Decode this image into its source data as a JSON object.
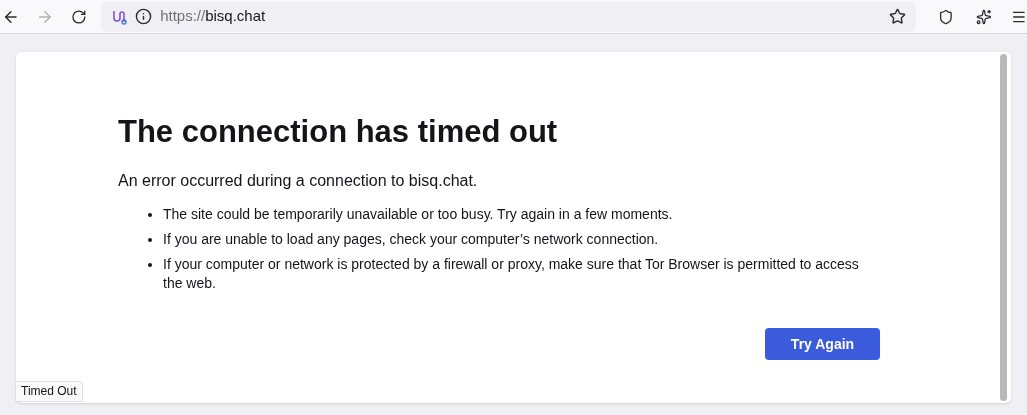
{
  "toolbar": {
    "back_disabled": false,
    "forward_disabled": true,
    "url": {
      "scheme": "https://",
      "host": "bisq.chat"
    }
  },
  "error": {
    "title": "The connection has timed out",
    "subtitle": "An error occurred during a connection to bisq.chat.",
    "bullets": [
      "The site could be temporarily unavailable or too busy. Try again in a few moments.",
      "If you are unable to load any pages, check your computer’s network connection.",
      "If your computer or network is protected by a firewall or proxy, make sure that Tor Browser is permitted to access the web."
    ],
    "button": "Try Again"
  },
  "status_bar": "Timed Out"
}
